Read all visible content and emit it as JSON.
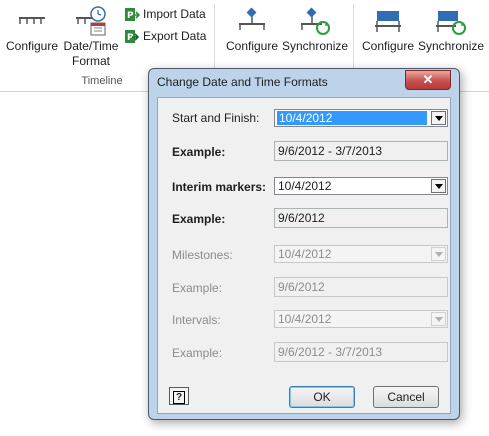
{
  "ribbon": {
    "configure_label": "Configure",
    "date_time_label_1": "Date/Time",
    "date_time_label_2": "Format",
    "import_label": "Import Data",
    "export_label": "Export Data",
    "group_timeline": "Timeline",
    "configure2_label": "Configure",
    "synchronize_label": "Synchronize",
    "configure3_label": "Configure",
    "synchronize2_label": "Synchronize"
  },
  "dialog": {
    "title": "Change Date and Time Formats",
    "close_glyph": "✕",
    "start_finish_label": "Start and Finish:",
    "start_finish_value": "10/4/2012",
    "example_label": "Example:",
    "start_finish_example": "9/6/2012 - 3/7/2013",
    "interim_label": "Interim markers:",
    "interim_value": "10/4/2012",
    "interim_example": "9/6/2012",
    "milestones_label": "Milestones:",
    "milestones_value": "10/4/2012",
    "milestones_example": "9/6/2012",
    "intervals_label": "Intervals:",
    "intervals_value": "10/4/2012",
    "intervals_example": "9/6/2012 - 3/7/2013",
    "help_glyph": "?",
    "ok_label": "OK",
    "cancel_label": "Cancel"
  },
  "colors": {
    "dialog_frame": "#bcd3ea",
    "selection": "#3399ff",
    "close_button": "#c75050"
  },
  "icons": [
    "configure-timeline-icon",
    "date-time-format-icon",
    "import-data-icon",
    "export-data-icon",
    "configure-milestone-icon",
    "synchronize-milestone-icon",
    "configure-interval-icon",
    "synchronize-interval-icon",
    "help-icon",
    "close-icon",
    "dropdown-arrow-icon"
  ]
}
